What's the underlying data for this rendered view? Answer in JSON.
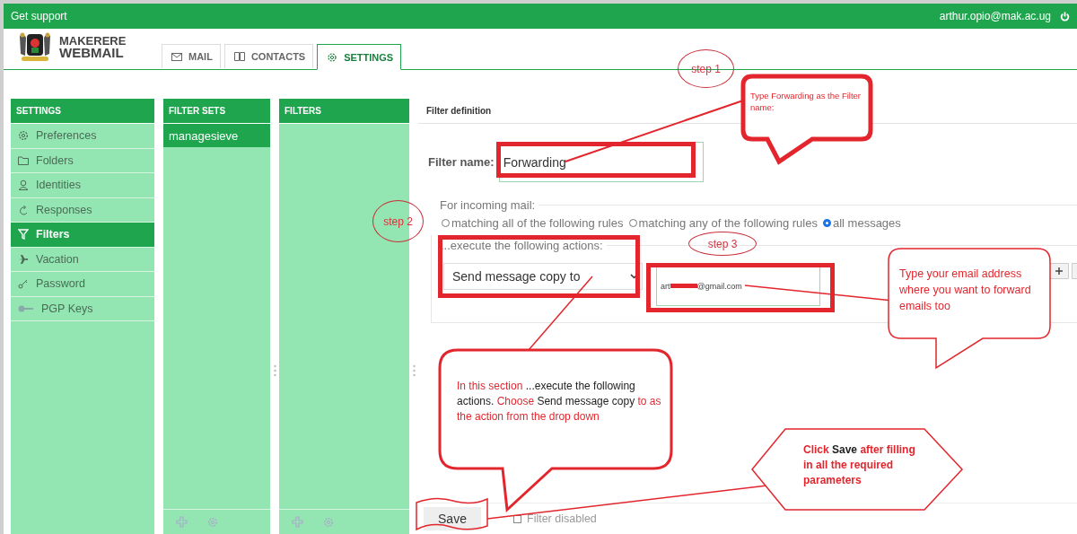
{
  "top_bar": {
    "support_link": "Get support",
    "user_email": "arthur.opio@mak.ac.ug"
  },
  "logo": {
    "line_1": "MAKERERE",
    "line_2": "WEBMAIL"
  },
  "tabs": [
    {
      "label": "MAIL",
      "selected": false
    },
    {
      "label": "CONTACTS",
      "selected": false
    },
    {
      "label": "SETTINGS",
      "selected": true
    }
  ],
  "settings_panel": {
    "title": "SETTINGS",
    "items": [
      {
        "label": "Preferences",
        "selected": false
      },
      {
        "label": "Folders",
        "selected": false
      },
      {
        "label": "Identities",
        "selected": false
      },
      {
        "label": "Responses",
        "selected": false
      },
      {
        "label": "Filters",
        "selected": true
      },
      {
        "label": "Vacation",
        "selected": false
      },
      {
        "label": "Password",
        "selected": false
      },
      {
        "label": "PGP Keys",
        "selected": false
      }
    ]
  },
  "filter_sets_panel": {
    "title": "FILTER SETS",
    "items": [
      {
        "label": "managesieve",
        "selected": true
      }
    ]
  },
  "filters_panel": {
    "title": "FILTERS"
  },
  "filter_definition": {
    "title": "Filter definition",
    "name_label": "Filter name:",
    "name_value": "Forwarding",
    "scope_legend": "For incoming mail:",
    "scope_options": [
      {
        "label": "matching all of the following rules",
        "selected": false
      },
      {
        "label": "matching any of the following rules",
        "selected": false
      },
      {
        "label": "all messages",
        "selected": true
      }
    ],
    "actions_legend": "...execute the following actions:",
    "action_select": "Send message copy to",
    "action_value_start": "art",
    "action_value_end": "@gmail.com",
    "save_button": "Save",
    "disabled_checkbox": {
      "label": "Filter disabled",
      "checked": false
    }
  },
  "annotations": {
    "step_labels": [
      "step 1",
      "step 2",
      "step 3"
    ],
    "callouts": [
      {
        "segments": [
          {
            "text": "Type Forwarding as the Filter name:",
            "emphasis": false
          }
        ]
      },
      {
        "segments": [
          {
            "text": "Type your email address where you want to forward emails too",
            "emphasis": false
          }
        ]
      },
      {
        "segments": [
          {
            "text": "In this section ",
            "emphasis": false
          },
          {
            "text": "...execute the following actions. ",
            "emphasis": true
          },
          {
            "text": "Choose ",
            "emphasis": false
          },
          {
            "text": "Send message copy ",
            "emphasis": true
          },
          {
            "text": "to as the action from the drop down",
            "emphasis": false
          }
        ]
      },
      {
        "segments": [
          {
            "text": "Click ",
            "emphasis": false
          },
          {
            "text": "Save ",
            "emphasis": true
          },
          {
            "text": "after filling in all the required parameters",
            "emphasis": false
          }
        ]
      }
    ]
  }
}
